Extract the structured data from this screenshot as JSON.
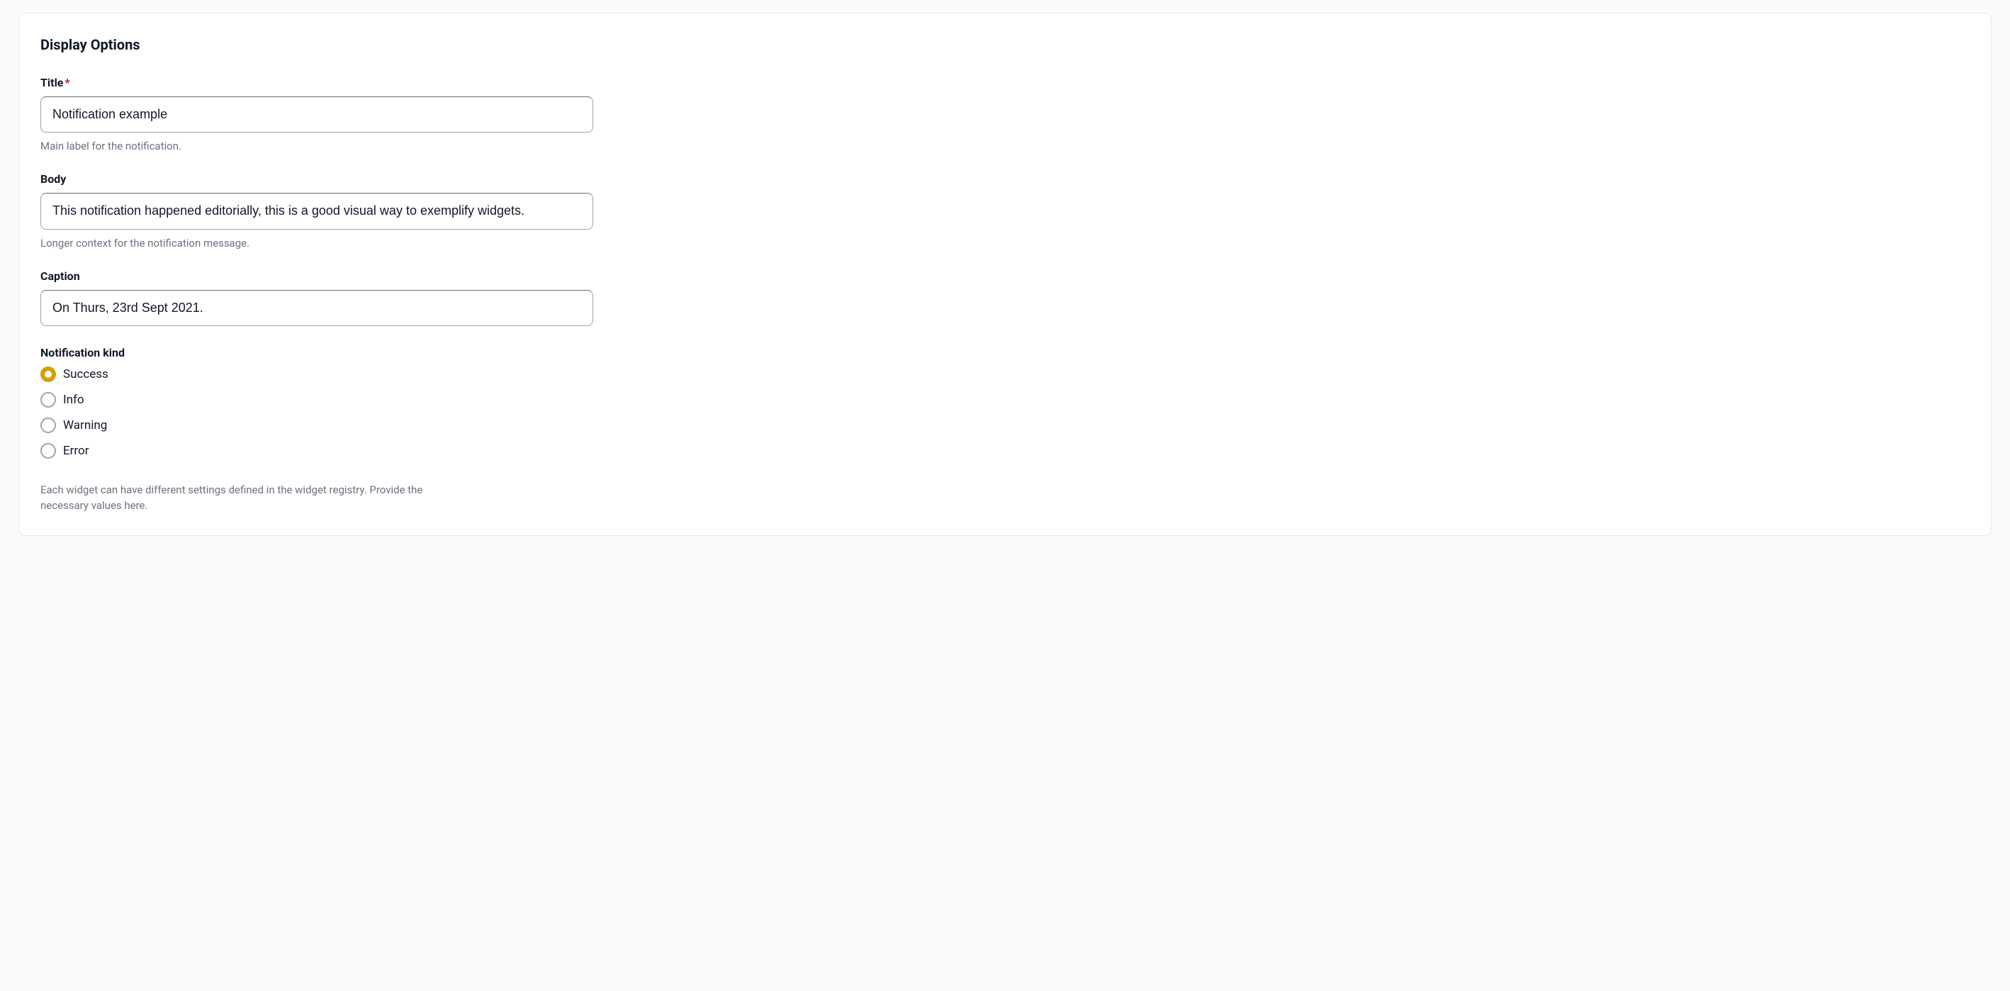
{
  "section_title": "Display Options",
  "fields": {
    "title": {
      "label": "Title",
      "required": true,
      "value": "Notification example",
      "help": "Main label for the notification."
    },
    "body": {
      "label": "Body",
      "required": false,
      "value": "This notification happened editorially, this is a good visual way to exemplify widgets.",
      "help": "Longer context for the notification message."
    },
    "caption": {
      "label": "Caption",
      "required": false,
      "value": "On Thurs, 23rd Sept 2021.",
      "help": ""
    },
    "kind": {
      "label": "Notification kind",
      "selected": "success",
      "options": [
        {
          "key": "success",
          "label": "Success"
        },
        {
          "key": "info",
          "label": "Info"
        },
        {
          "key": "warning",
          "label": "Warning"
        },
        {
          "key": "error",
          "label": "Error"
        }
      ]
    }
  },
  "footer_help": "Each widget can have different settings defined in the widget registry. Provide the necessary values here."
}
